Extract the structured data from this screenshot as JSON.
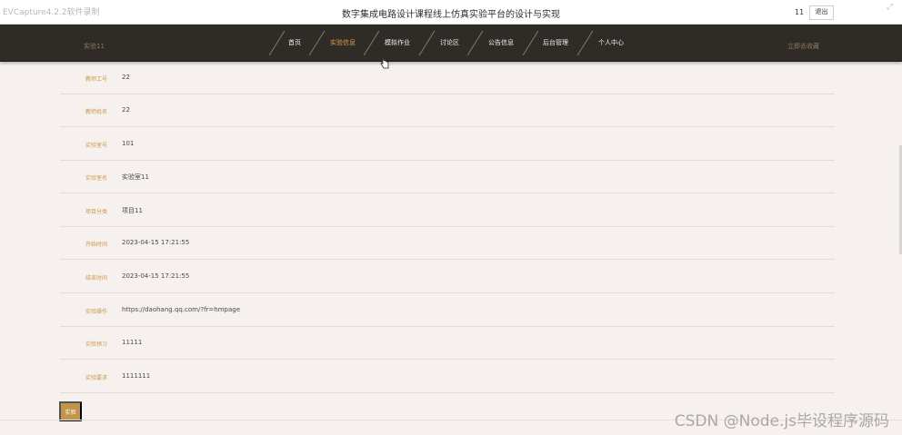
{
  "window": {
    "recorder_label": "EVCapture4.2.2软件录制",
    "site_title": "数字集成电路设计课程线上仿真实验平台的设计与实现",
    "user_name": "11",
    "logout_label": "退出"
  },
  "nav": {
    "page_heading": "实验11",
    "items": [
      {
        "label": "首页"
      },
      {
        "label": "实验信息"
      },
      {
        "label": "模拟作业"
      },
      {
        "label": "讨论区"
      },
      {
        "label": "公告信息"
      },
      {
        "label": "后台管理"
      },
      {
        "label": "个人中心"
      }
    ],
    "active_index": 1,
    "right_link": "立即去收藏"
  },
  "detail": {
    "rows": [
      {
        "label": "教师工号",
        "value": "22"
      },
      {
        "label": "教师姓名",
        "value": "22"
      },
      {
        "label": "实验室号",
        "value": "101"
      },
      {
        "label": "实验室名",
        "value": "实验室11"
      },
      {
        "label": "项目分类",
        "value": "项目11"
      },
      {
        "label": "开始时间",
        "value": "2023-04-15 17:21:55"
      },
      {
        "label": "结束时间",
        "value": "2023-04-15 17:21:55"
      },
      {
        "label": "实验操作",
        "value": "https://daohang.qq.com/?fr=hmpage"
      },
      {
        "label": "实验预习",
        "value": "11111"
      },
      {
        "label": "实验要求",
        "value": "1111111"
      }
    ],
    "submit_label": "实验"
  },
  "watermark": "CSDN @Node.js毕设程序源码",
  "colors": {
    "nav_bg": "#2f2c28",
    "accent": "#d8a24c",
    "label": "#c99846",
    "button": "#c2964a",
    "page_bg": "#f6f1ee"
  }
}
